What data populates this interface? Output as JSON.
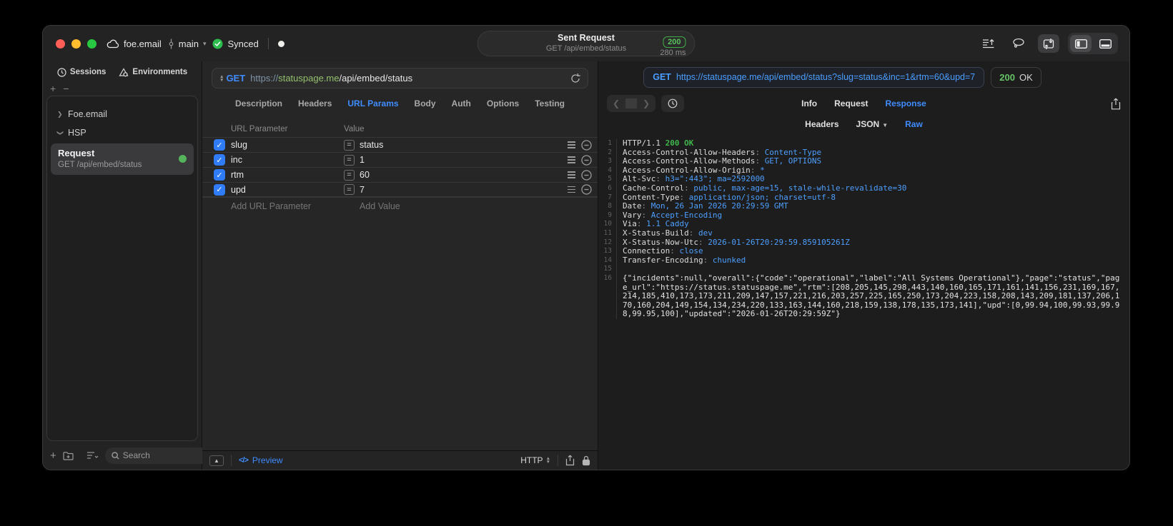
{
  "colors": {
    "accent_blue": "#3f8cff",
    "success_green": "#3fb54b",
    "url_host_green": "#93c06d",
    "checkbox_blue": "#2f7cf6",
    "traffic_red": "#ff5f57",
    "traffic_yellow": "#febc2e",
    "traffic_green": "#28c840"
  },
  "titlebar": {
    "project": "foe.email",
    "branch": "main",
    "sync_status": "Synced",
    "request_summary": {
      "title": "Sent Request",
      "subtitle": "GET /api/embed/status",
      "status_code": "200",
      "duration": "280 ms"
    }
  },
  "sidebar": {
    "tabs": [
      {
        "label": "Sessions"
      },
      {
        "label": "Environments"
      }
    ],
    "groups": [
      {
        "label": "Foe.email",
        "expanded": false
      },
      {
        "label": "HSP",
        "expanded": true
      }
    ],
    "request_item": {
      "title": "Request",
      "subtitle": "GET /api/embed/status"
    },
    "search_placeholder": "Search"
  },
  "request_panel": {
    "method": "GET",
    "url": {
      "scheme": "https://",
      "host": "statuspage.me",
      "path": "/api/embed/status"
    },
    "tabs": [
      "Description",
      "Headers",
      "URL Params",
      "Body",
      "Auth",
      "Options",
      "Testing"
    ],
    "active_tab": "URL Params",
    "params_table": {
      "columns": [
        "URL Parameter",
        "Value"
      ],
      "rows": [
        {
          "enabled": true,
          "name": "slug",
          "value": "status"
        },
        {
          "enabled": true,
          "name": "inc",
          "value": "1"
        },
        {
          "enabled": true,
          "name": "rtm",
          "value": "60"
        },
        {
          "enabled": true,
          "name": "upd",
          "value": "7"
        }
      ],
      "add_name_placeholder": "Add URL Parameter",
      "add_value_placeholder": "Add Value"
    },
    "footer": {
      "preview_label": "Preview",
      "code_glyph": "</>",
      "protocol_label": "HTTP"
    }
  },
  "response_panel": {
    "request_line": {
      "method": "GET",
      "url": "https://statuspage.me/api/embed/status?slug=status&inc=1&rtm=60&upd=7"
    },
    "status": {
      "code": "200",
      "text": "OK"
    },
    "tabs": [
      "Info",
      "Request",
      "Response"
    ],
    "active_tab": "Response",
    "subtabs": [
      "Headers",
      "JSON",
      "Raw"
    ],
    "active_subtab": "Raw",
    "body_lines": [
      {
        "n": "1",
        "type": "status",
        "protocol": "HTTP/1.1",
        "status": "200 OK"
      },
      {
        "n": "2",
        "type": "header",
        "name": "Access-Control-Allow-Headers",
        "value": "Content-Type"
      },
      {
        "n": "3",
        "type": "header",
        "name": "Access-Control-Allow-Methods",
        "value": "GET, OPTIONS"
      },
      {
        "n": "4",
        "type": "header",
        "name": "Access-Control-Allow-Origin",
        "value": "*"
      },
      {
        "n": "5",
        "type": "header",
        "name": "Alt-Svc",
        "value": "h3=\":443\"; ma=2592000"
      },
      {
        "n": "6",
        "type": "header",
        "name": "Cache-Control",
        "value": "public, max-age=15, stale-while-revalidate=30"
      },
      {
        "n": "7",
        "type": "header",
        "name": "Content-Type",
        "value": "application/json; charset=utf-8"
      },
      {
        "n": "8",
        "type": "header",
        "name": "Date",
        "value": "Mon, 26 Jan 2026 20:29:59 GMT"
      },
      {
        "n": "9",
        "type": "header",
        "name": "Vary",
        "value": "Accept-Encoding"
      },
      {
        "n": "10",
        "type": "header",
        "name": "Via",
        "value": "1.1 Caddy"
      },
      {
        "n": "11",
        "type": "header",
        "name": "X-Status-Build",
        "value": "dev"
      },
      {
        "n": "12",
        "type": "header",
        "name": "X-Status-Now-Utc",
        "value": "2026-01-26T20:29:59.859105261Z"
      },
      {
        "n": "13",
        "type": "header",
        "name": "Connection",
        "value": "close"
      },
      {
        "n": "14",
        "type": "header",
        "name": "Transfer-Encoding",
        "value": "chunked"
      },
      {
        "n": "15",
        "type": "blank"
      },
      {
        "n": "16",
        "type": "json",
        "text": "{\"incidents\":null,\"overall\":{\"code\":\"operational\",\"label\":\"All Systems Operational\"},\"page\":\"status\",\"page_url\":\"https://status.statuspage.me\",\"rtm\":[208,205,145,298,443,140,160,165,171,161,141,156,231,169,167,214,185,410,173,173,211,209,147,157,221,216,203,257,225,165,250,173,204,223,158,208,143,209,181,137,206,170,160,204,149,154,134,234,220,133,163,144,160,218,159,138,178,135,173,141],\"upd\":[0,99.94,100,99.93,99.98,99.95,100],\"updated\":\"2026-01-26T20:29:59Z\"}"
      }
    ]
  }
}
